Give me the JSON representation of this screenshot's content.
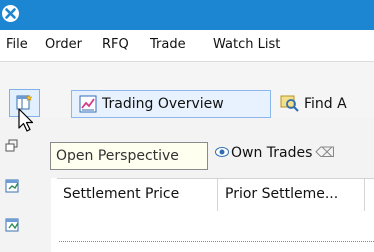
{
  "window": {
    "app_icon": "app-logo-icon"
  },
  "menu": {
    "items": [
      {
        "label": "File"
      },
      {
        "label": "Order"
      },
      {
        "label": "RFQ"
      },
      {
        "label": "Trade"
      },
      {
        "label": "Watch List"
      }
    ]
  },
  "toolbar": {
    "perspective_icon": "open-perspective-icon",
    "overview_label": "Trading Overview",
    "find_label": "Find A"
  },
  "tooltip": {
    "text": "Open Perspective"
  },
  "tabs": {
    "own_trades_label": "Own Trades",
    "close_glyph": "⌫"
  },
  "table": {
    "columns": [
      {
        "label": "Settlement Price"
      },
      {
        "label": "Prior Settleme..."
      }
    ]
  },
  "colors": {
    "titlebar": "#1c86d2",
    "selection": "#e2efff"
  }
}
